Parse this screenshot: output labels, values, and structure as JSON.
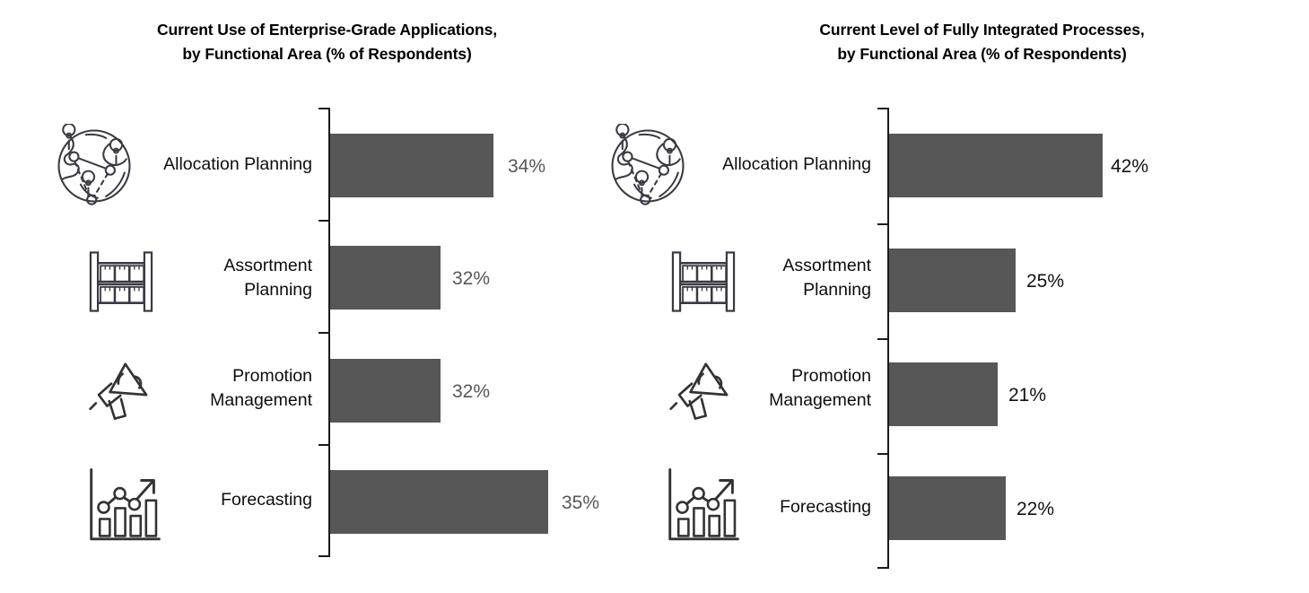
{
  "chart_data": [
    {
      "type": "bar",
      "orientation": "horizontal",
      "title": "Current Use of Enterprise-Grade Applications,\nby Functional Area (% of Respondents)",
      "categories": [
        "Allocation Planning",
        "Assortment\nPlanning",
        "Promotion\nManagement",
        "Forecasting"
      ],
      "values": [
        34,
        32,
        32,
        35
      ],
      "value_labels": [
        "34%",
        "32%",
        "32%",
        "35%"
      ],
      "icons": [
        "globe-network-icon",
        "shelving-rack-icon",
        "megaphone-icon",
        "growth-chart-icon"
      ],
      "xlabel": "",
      "ylabel": "",
      "grid": false,
      "legend": null,
      "bar_color": "#575757",
      "value_label_color": "#575757",
      "category_label_color": "#0d0d0d"
    },
    {
      "type": "bar",
      "orientation": "horizontal",
      "title": "Current Level of Fully Integrated Processes,\nby Functional Area (% of Respondents)",
      "categories": [
        "Allocation Planning",
        "Assortment\nPlanning",
        "Promotion\nManagement",
        "Forecasting"
      ],
      "values": [
        42,
        25,
        21,
        22
      ],
      "value_labels": [
        "42%",
        "25%",
        "21%",
        "22%"
      ],
      "icons": [
        "globe-network-icon",
        "shelving-rack-icon",
        "megaphone-icon",
        "growth-chart-icon"
      ],
      "xlabel": "",
      "ylabel": "",
      "grid": false,
      "legend": null,
      "bar_color": "#575757",
      "value_label_color": "#121212",
      "category_label_color": "#0d0d0d"
    }
  ],
  "left": {
    "title": "Current Use of Enterprise-Grade Applications,\nby Functional Area (% of Respondents)",
    "rows": [
      {
        "label": "Allocation Planning",
        "value_label": "34%",
        "icon": "globe-network-icon"
      },
      {
        "label": "Assortment\nPlanning",
        "value_label": "32%",
        "icon": "shelving-rack-icon"
      },
      {
        "label": "Promotion\nManagement",
        "value_label": "32%",
        "icon": "megaphone-icon"
      },
      {
        "label": "Forecasting",
        "value_label": "35%",
        "icon": "growth-chart-icon"
      }
    ]
  },
  "right": {
    "title": "Current Level of Fully Integrated Processes,\nby Functional Area (% of Respondents)",
    "rows": [
      {
        "label": "Allocation Planning",
        "value_label": "42%",
        "icon": "globe-network-icon"
      },
      {
        "label": "Assortment\nPlanning",
        "value_label": "25%",
        "icon": "shelving-rack-icon"
      },
      {
        "label": "Promotion\nManagement",
        "value_label": "21%",
        "icon": "megaphone-icon"
      },
      {
        "label": "Forecasting",
        "value_label": "22%",
        "icon": "growth-chart-icon"
      }
    ]
  }
}
